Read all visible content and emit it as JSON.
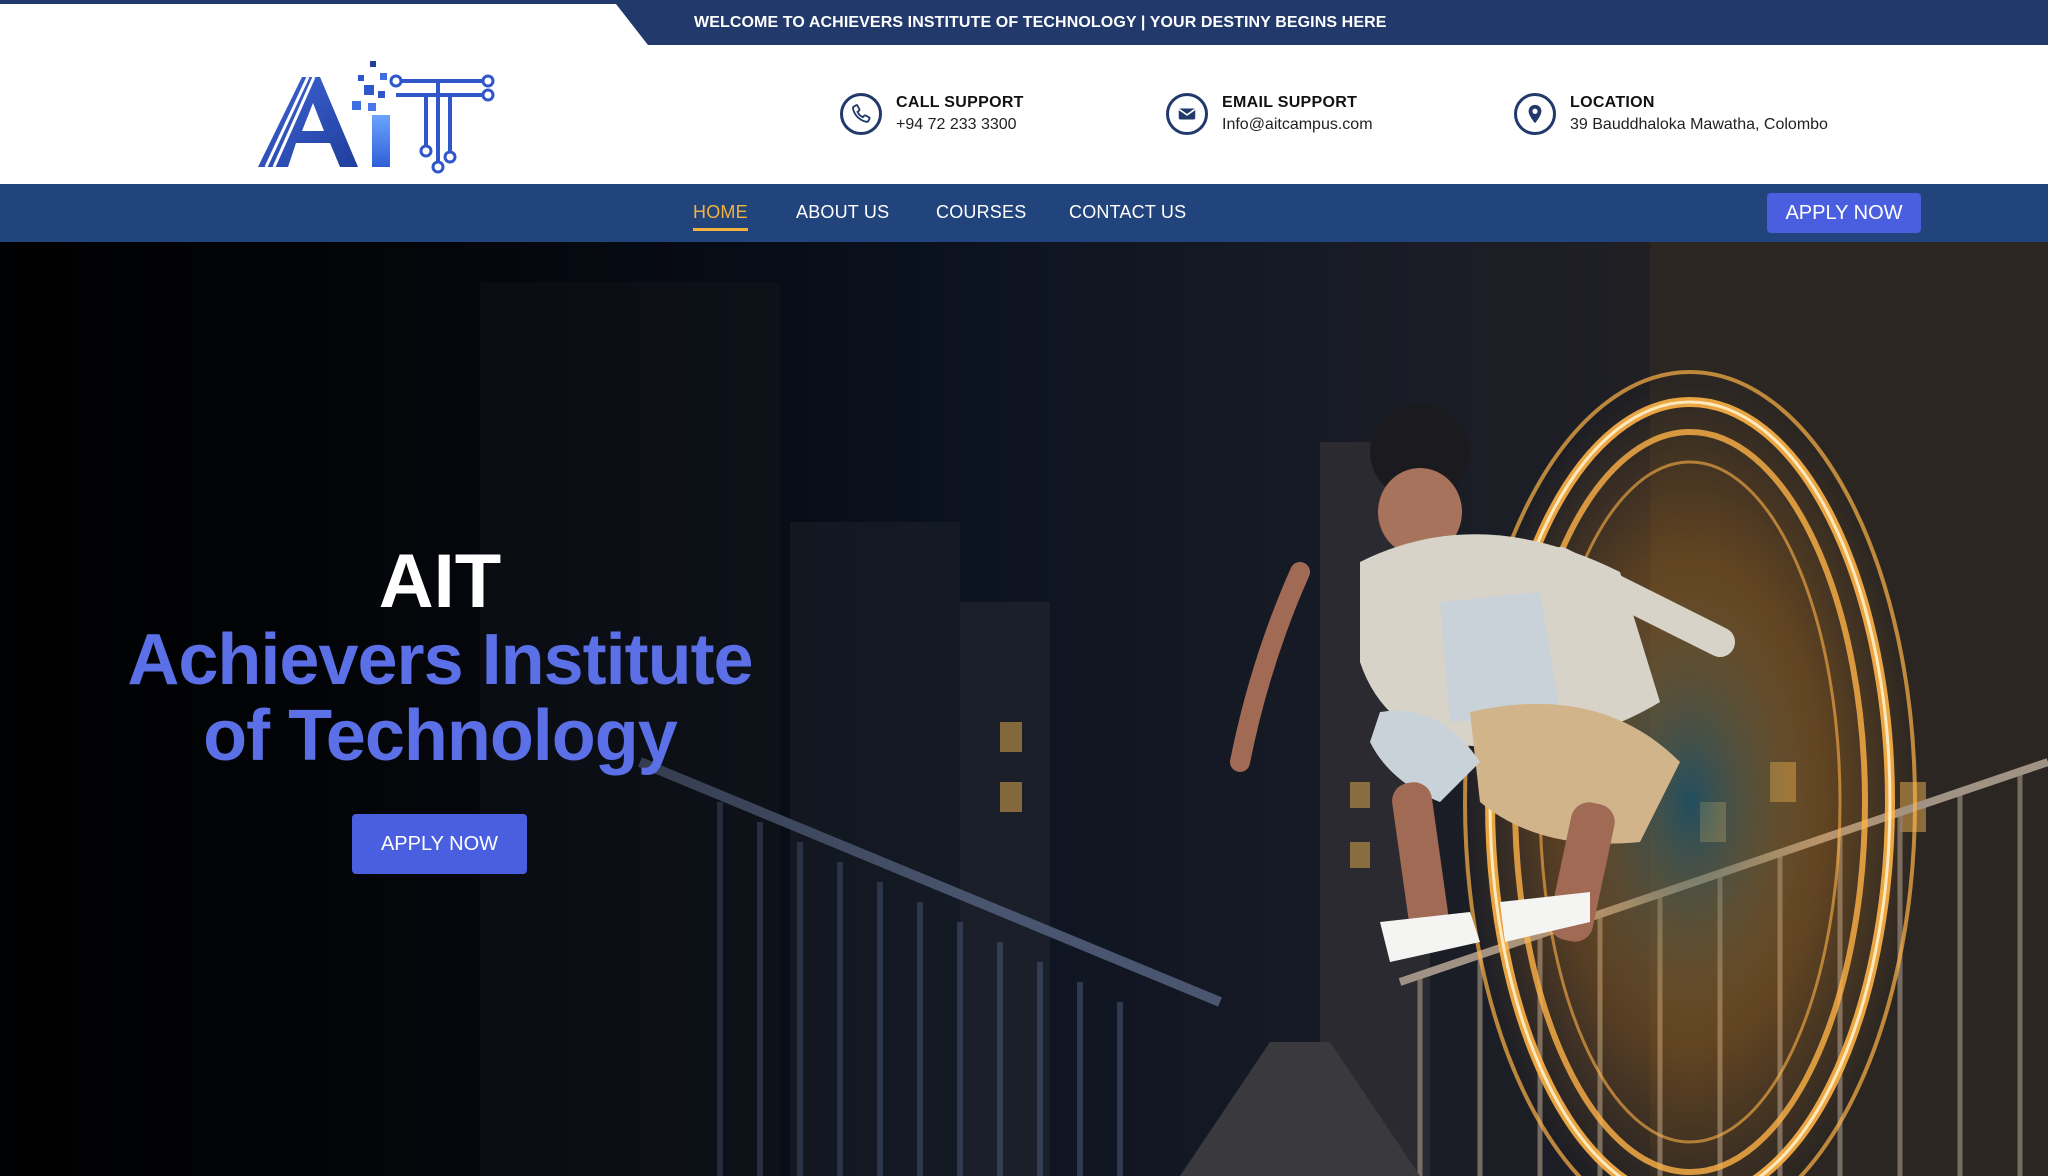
{
  "topbar": {
    "text": "WELCOME TO ACHIEVERS INSTITUTE OF TECHNOLOGY | YOUR DESTINY BEGINS HERE"
  },
  "header": {
    "logo_text": "AIT",
    "contacts": [
      {
        "icon": "phone-icon",
        "title": "CALL SUPPORT",
        "value": "+94 72 233 3300"
      },
      {
        "icon": "email-icon",
        "title": "EMAIL SUPPORT",
        "value": "Info@aitcampus.com"
      },
      {
        "icon": "location-pin-icon",
        "title": "LOCATION",
        "value": "39 Bauddhaloka Mawatha, Colombo"
      }
    ]
  },
  "nav": {
    "items": [
      {
        "label": "HOME",
        "active": true
      },
      {
        "label": "ABOUT US",
        "active": false
      },
      {
        "label": "COURSES",
        "active": false
      },
      {
        "label": "CONTACT US",
        "active": false
      }
    ],
    "apply_label": "APPLY NOW"
  },
  "hero": {
    "title": "AIT",
    "subtitle_line1": "Achievers Institute",
    "subtitle_line2": "of Technology",
    "apply_label": "APPLY NOW"
  },
  "colors": {
    "topbar": "#22396b",
    "nav": "#22447c",
    "accent": "#4a5fe0",
    "active_nav": "#f3b23e",
    "hero_subtitle": "#5b6fe6"
  }
}
